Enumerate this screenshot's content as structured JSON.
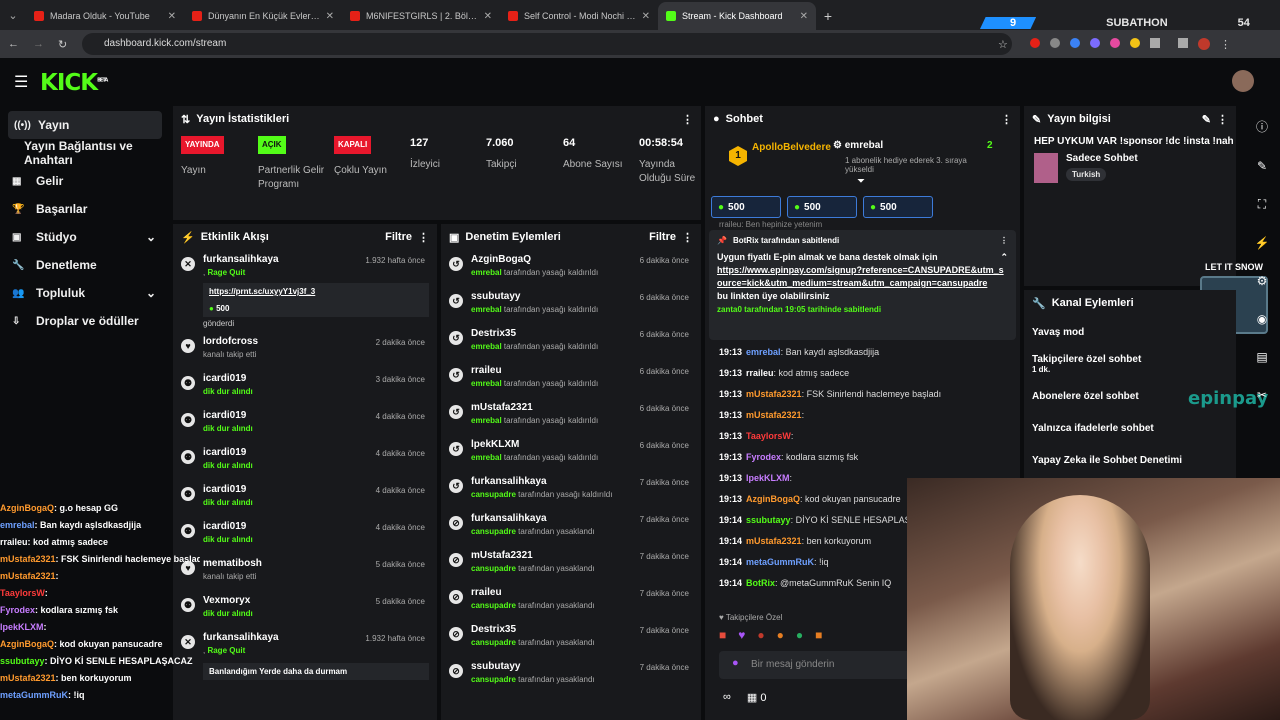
{
  "browser": {
    "tabs": [
      {
        "title": "Madara Olduk - YouTube",
        "kind": "youtube"
      },
      {
        "title": "Dünyanın En Küçük Evleri: 1,5 m",
        "kind": "youtube"
      },
      {
        "title": "M6NIFESTGIRLS | 2. Bölüm - You",
        "kind": "youtube"
      },
      {
        "title": "Self Control - Modi Nochi & Tir",
        "kind": "youtube"
      },
      {
        "title": "Stream - Kick Dashboard",
        "kind": "kick"
      }
    ],
    "url": "dashboard.kick.com/stream",
    "subathon_left": "9",
    "subathon_label": "SUBATHON",
    "subathon_right": "54"
  },
  "logo": "KICK",
  "logo_sup": "BETA",
  "sidebar": {
    "items": [
      {
        "label": "Yayın",
        "icon": "broadcast-icon"
      },
      {
        "label": "Yayın Bağlantısı ve Anahtarı",
        "icon": ""
      },
      {
        "label": "Gelir",
        "icon": "revenue-icon"
      },
      {
        "label": "Başarılar",
        "icon": "trophy-icon"
      },
      {
        "label": "Stüdyo",
        "icon": "studio-icon",
        "chevron": true
      },
      {
        "label": "Denetleme",
        "icon": "wrench-icon"
      },
      {
        "label": "Topluluk",
        "icon": "community-icon",
        "chevron": true
      },
      {
        "label": "Droplar ve ödüller",
        "icon": "drops-icon"
      }
    ]
  },
  "stats": {
    "title": "Yayın İstatistikleri",
    "items": [
      {
        "badge": "YAYINDA",
        "badge_color": "#e8172c",
        "label": "Yayın"
      },
      {
        "badge": "AÇIK",
        "badge_color": "#53fc18",
        "label": "Partnerlik Gelir Programı"
      },
      {
        "badge": "KAPALI",
        "badge_color": "#e8172c",
        "label": "Çoklu Yayın"
      },
      {
        "value": "127",
        "label": "İzleyici"
      },
      {
        "value": "7.060",
        "label": "Takipçi"
      },
      {
        "value": "64",
        "label": "Abone Sayısı"
      },
      {
        "value": "00:58:54",
        "label": "Yayında Olduğu Süre"
      }
    ]
  },
  "activity": {
    "title": "Etkinlik Akışı",
    "filter": "Filtre",
    "rows": [
      {
        "name": "furkansalihkaya",
        "sub": "Rage Quit",
        "time": "1.932 hafta önce",
        "link": "https://prnt.sc/uxyyY1vj3f_3",
        "amount": "500",
        "tail": "gönderdi"
      },
      {
        "name": "lordofcross",
        "sub": "kanalı takip etti",
        "time": "2 dakika önce"
      },
      {
        "name": "icardi019",
        "sub": "dik dur alındı",
        "time": "3 dakika önce"
      },
      {
        "name": "icardi019",
        "sub": "dik dur alındı",
        "time": "4 dakika önce"
      },
      {
        "name": "icardi019",
        "sub": "dik dur alındı",
        "time": "4 dakika önce"
      },
      {
        "name": "icardi019",
        "sub": "dik dur alındı",
        "time": "4 dakika önce"
      },
      {
        "name": "icardi019",
        "sub": "dik dur alındı",
        "time": "4 dakika önce"
      },
      {
        "name": "mematibosh",
        "sub": "kanalı takip etti",
        "time": "5 dakika önce"
      },
      {
        "name": "Vexmoryx",
        "sub": "dik dur alındı",
        "time": "5 dakika önce"
      },
      {
        "name": "furkansalihkaya",
        "sub": "Rage Quit",
        "time": "1.932 hafta önce",
        "tail": "Banlandığım Yerde daha da durmam"
      }
    ]
  },
  "moderation": {
    "title": "Denetim Eylemleri",
    "filter": "Filtre",
    "rows": [
      {
        "name": "AzginBogaQ",
        "by": "emrebal",
        "act": "tarafından yasağı kaldırıldı",
        "time": "6 dakika önce"
      },
      {
        "name": "ssubutayy",
        "by": "emrebal",
        "act": "tarafından yasağı kaldırıldı",
        "time": "6 dakika önce"
      },
      {
        "name": "Destrix35",
        "by": "emrebal",
        "act": "tarafından yasağı kaldırıldı",
        "time": "6 dakika önce"
      },
      {
        "name": "rraileu",
        "by": "emrebal",
        "act": "tarafından yasağı kaldırıldı",
        "time": "6 dakika önce"
      },
      {
        "name": "mUstafa2321",
        "by": "emrebal",
        "act": "tarafından yasağı kaldırıldı",
        "time": "6 dakika önce"
      },
      {
        "name": "lpekKLXM",
        "by": "emrebal",
        "act": "tarafından yasağı kaldırıldı",
        "time": "6 dakika önce"
      },
      {
        "name": "furkansalihkaya",
        "by": "cansupadre",
        "act": "tarafından yasağı kaldırıldı",
        "time": "7 dakika önce"
      },
      {
        "name": "furkansalihkaya",
        "by": "cansupadre",
        "act": "tarafından yasaklandı",
        "time": "7 dakika önce"
      },
      {
        "name": "mUstafa2321",
        "by": "cansupadre",
        "act": "tarafından yasaklandı",
        "time": "7 dakika önce"
      },
      {
        "name": "rraileu",
        "by": "cansupadre",
        "act": "tarafından yasaklandı",
        "time": "7 dakika önce"
      },
      {
        "name": "Destrix35",
        "by": "cansupadre",
        "act": "tarafından yasaklandı",
        "time": "7 dakika önce"
      },
      {
        "name": "ssubutayy",
        "by": "cansupadre",
        "act": "tarafından yasaklandı",
        "time": "7 dakika önce"
      }
    ]
  },
  "chat": {
    "title": "Sohbet",
    "top_user": "ApolloBelvedere",
    "top_rank": "1",
    "gift_user": "emrebal",
    "gift_count": "2",
    "gift_text": "1 abonelik hediye ederek 3. sıraya yükseldi",
    "pills": [
      "500",
      "500",
      "500"
    ],
    "scrolled_line": "rraileu: Ben hepinize yetenim",
    "pinned_by": "BotRix tarafından sabitlendi",
    "pinned_msg": "Uygun fiyatlı E-pin almak ve bana destek olmak için",
    "pinned_link": "https://www.epinpay.com/signup?reference=CANSUPADRE&utm_source=kick&utm_medium=stream&utm_campaign=cansupadre",
    "pinned_tail": "bu linkten üye olabilirsiniz",
    "pinned_footer": "zanta0 tarafından 19:05 tarihinde sabitlendi",
    "lines": [
      {
        "t": "19:13",
        "u": "emrebal",
        "c": "#6ea0ff",
        "m": ": Ban kaydı aşlsdkasdjija"
      },
      {
        "t": "19:13",
        "u": "rraileu",
        "c": "#ffffff",
        "m": ": kod atmış sadece"
      },
      {
        "t": "19:13",
        "u": "mUstafa2321",
        "c": "#ff9a2e",
        "m": ": FSK Sinirlendi haclemeye başladı"
      },
      {
        "t": "19:13",
        "u": "mUstafa2321",
        "c": "#ff9a2e",
        "m": ":"
      },
      {
        "t": "19:13",
        "u": "TaaylorsW",
        "c": "#ff3b3b",
        "m": ":"
      },
      {
        "t": "19:13",
        "u": "Fyrodex",
        "c": "#c77dff",
        "m": ": kodlara sızmış fsk"
      },
      {
        "t": "19:13",
        "u": "lpekKLXM",
        "c": "#c77dff",
        "m": ":"
      },
      {
        "t": "19:13",
        "u": "AzginBogaQ",
        "c": "#ff9a2e",
        "m": ": kod okuyan pansucadre"
      },
      {
        "t": "19:14",
        "u": "ssubutayy",
        "c": "#53fc18",
        "m": ": DİYO Kİ SENLE HESAPLAŞACAZ"
      },
      {
        "t": "19:14",
        "u": "mUstafa2321",
        "c": "#ff9a2e",
        "m": ": ben korkuyorum"
      },
      {
        "t": "19:14",
        "u": "metaGummRuK",
        "c": "#6ea0ff",
        "m": ": !iq"
      },
      {
        "t": "19:14",
        "u": "BotRix",
        "c": "#53fc18",
        "m": ": @metaGummRuK Senin IQ"
      }
    ],
    "mode": "Takipçilere Özel",
    "input_placeholder": "Bir mesaj gönderin",
    "footer_count": "0"
  },
  "info": {
    "title": "Yayın bilgisi",
    "stream_title": "HEP UYKUM VAR !sponsor !dc !insta !nah",
    "category": "Sadece Sohbet",
    "tag": "Turkish"
  },
  "channel_actions": {
    "title": "Kanal Eylemleri",
    "items": [
      "Yavaş mod",
      "Takipçilere özel sohbet",
      "Abonelere özel sohbet",
      "Yalnızca ifadelerle sohbet",
      "Yapay Zeka ile Sohbet Denetimi"
    ],
    "follower_sub": "1 dk."
  },
  "overlay_chat": [
    {
      "u": "AzginBogaQ",
      "c": "#ff9a2e",
      "m": ": g.o hesap GG"
    },
    {
      "u": "emrebal",
      "c": "#6ea0ff",
      "m": ": Ban kaydı aşlsdkasdjija"
    },
    {
      "u": "rraileu",
      "c": "#ffffff",
      "m": ": kod atmış sadece"
    },
    {
      "u": "mUstafa2321",
      "c": "#ff9a2e",
      "m": ": FSK Sinirlendi haclemeye başladı"
    },
    {
      "u": "mUstafa2321",
      "c": "#ff9a2e",
      "m": ":"
    },
    {
      "u": "TaaylorsW",
      "c": "#ff3b3b",
      "m": ":"
    },
    {
      "u": "Fyrodex",
      "c": "#c77dff",
      "m": ": kodlara sızmış fsk"
    },
    {
      "u": "lpekKLXM",
      "c": "#c77dff",
      "m": ":"
    },
    {
      "u": "AzginBogaQ",
      "c": "#ff9a2e",
      "m": ": kod okuyan pansucadre"
    },
    {
      "u": "ssubutayy",
      "c": "#53fc18",
      "m": ": DİYO Kİ SENLE HESAPLAŞACAZ"
    },
    {
      "u": "mUstafa2321",
      "c": "#ff9a2e",
      "m": ": ben korkuyorum"
    },
    {
      "u": "metaGummRuK",
      "c": "#6ea0ff",
      "m": ": !iq"
    }
  ],
  "overlay_labels": {
    "snow": "LET IT SNOW",
    "epin": "epinpay"
  }
}
